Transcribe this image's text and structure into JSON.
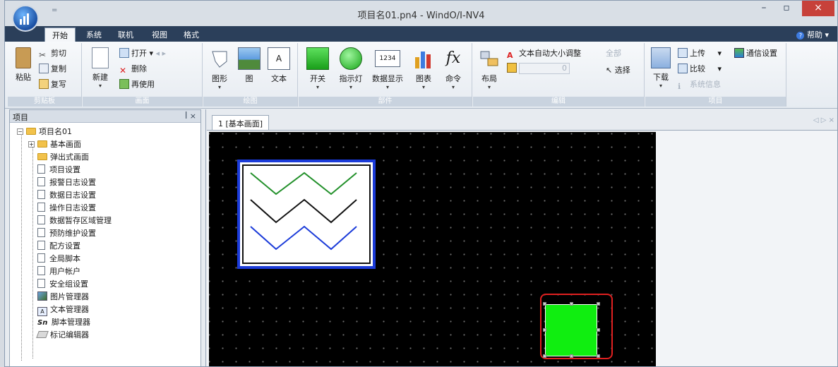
{
  "window": {
    "title": "项目名01.pn4 - WindO/I-NV4",
    "qat_glyph": "="
  },
  "ribbon_tabs": [
    "开始",
    "系统",
    "联机",
    "视图",
    "格式"
  ],
  "help_label": "帮助",
  "ribbon": {
    "clipboard": {
      "title": "剪贴板",
      "paste": "粘贴",
      "cut": "剪切",
      "copy": "复制",
      "duplicate": "复写"
    },
    "screen": {
      "title": "画面",
      "new": "新建",
      "open": "打开",
      "delete": "删除",
      "reuse": "再使用"
    },
    "drawing": {
      "title": "绘图",
      "shape": "图形",
      "picture": "图",
      "text": "文本"
    },
    "parts": {
      "title": "部件",
      "switch": "开关",
      "pilot_lamp": "指示灯",
      "numeric_display": "数据显示",
      "numeric_icon_text": "1234",
      "chart": "图表",
      "command": "命令"
    },
    "edit": {
      "title": "编辑",
      "layout": "布局",
      "auto_text_size": "文本自动大小调整",
      "stepper_value": "0",
      "deselect": "全部",
      "select": "选择"
    },
    "project": {
      "title": "项目",
      "download": "下载",
      "upload": "上传",
      "compare": "比较",
      "system_info": "系统信息",
      "comm_settings": "通信设置"
    }
  },
  "left_panel": {
    "title": "项目",
    "controls": "ꟾ ×",
    "tree": [
      {
        "label": "项目名01",
        "icon": "folder"
      },
      {
        "label": "基本画面",
        "icon": "folder"
      },
      {
        "label": "弹出式画面",
        "icon": "folder"
      },
      {
        "label": "项目设置",
        "icon": "doc"
      },
      {
        "label": "报警日志设置",
        "icon": "doc"
      },
      {
        "label": "数据日志设置",
        "icon": "doc"
      },
      {
        "label": "操作日志设置",
        "icon": "doc"
      },
      {
        "label": "数据暂存区域管理",
        "icon": "doc"
      },
      {
        "label": "预防维护设置",
        "icon": "doc"
      },
      {
        "label": "配方设置",
        "icon": "doc"
      },
      {
        "label": "全局脚本",
        "icon": "doc"
      },
      {
        "label": "用户帐户",
        "icon": "doc"
      },
      {
        "label": "安全组设置",
        "icon": "doc"
      },
      {
        "label": "图片管理器",
        "icon": "image"
      },
      {
        "label": "文本管理器",
        "icon": "text"
      },
      {
        "label": "脚本管理器",
        "icon": "script"
      },
      {
        "label": "标记编辑器",
        "icon": "tag"
      }
    ]
  },
  "editor": {
    "tab_label": "1  [基本画面]",
    "tab_controls": "◁ ▷ ×"
  },
  "colors": {
    "screen_bg": "#000000",
    "chart_border": "#1b3bd9",
    "lamp_green": "#10ee10",
    "selection_highlight": "#e02020"
  }
}
